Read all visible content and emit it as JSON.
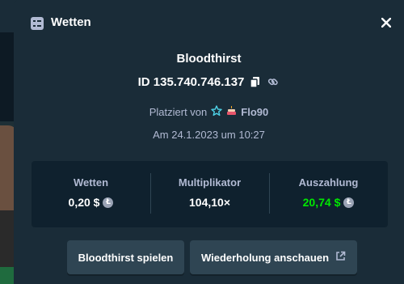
{
  "header": {
    "title": "Wetten",
    "title_icon": "bets-list-icon",
    "close_icon": "close-icon"
  },
  "bet": {
    "game_name": "Bloodthirst",
    "id_text": "ID 135.740.746.137",
    "placed_prefix": "Platziert von",
    "username": "Flo90",
    "date_text": "Am 24.1.2023 um 10:27"
  },
  "stats": {
    "wager_label": "Wetten",
    "wager_value": "0,20 $",
    "multiplier_label": "Multiplikator",
    "multiplier_value": "104,10×",
    "payout_label": "Auszahlung",
    "payout_value": "20,74 $",
    "currency_symbol": "Ł"
  },
  "buttons": {
    "play_label": "Bloodthirst spielen",
    "replay_label": "Wiederholung anschauen"
  },
  "colors": {
    "modal_bg": "#1a2c38",
    "panel_bg": "#0f212e",
    "button_bg": "#2f4553",
    "muted_text": "#b1bad3",
    "win_green": "#00e701"
  }
}
